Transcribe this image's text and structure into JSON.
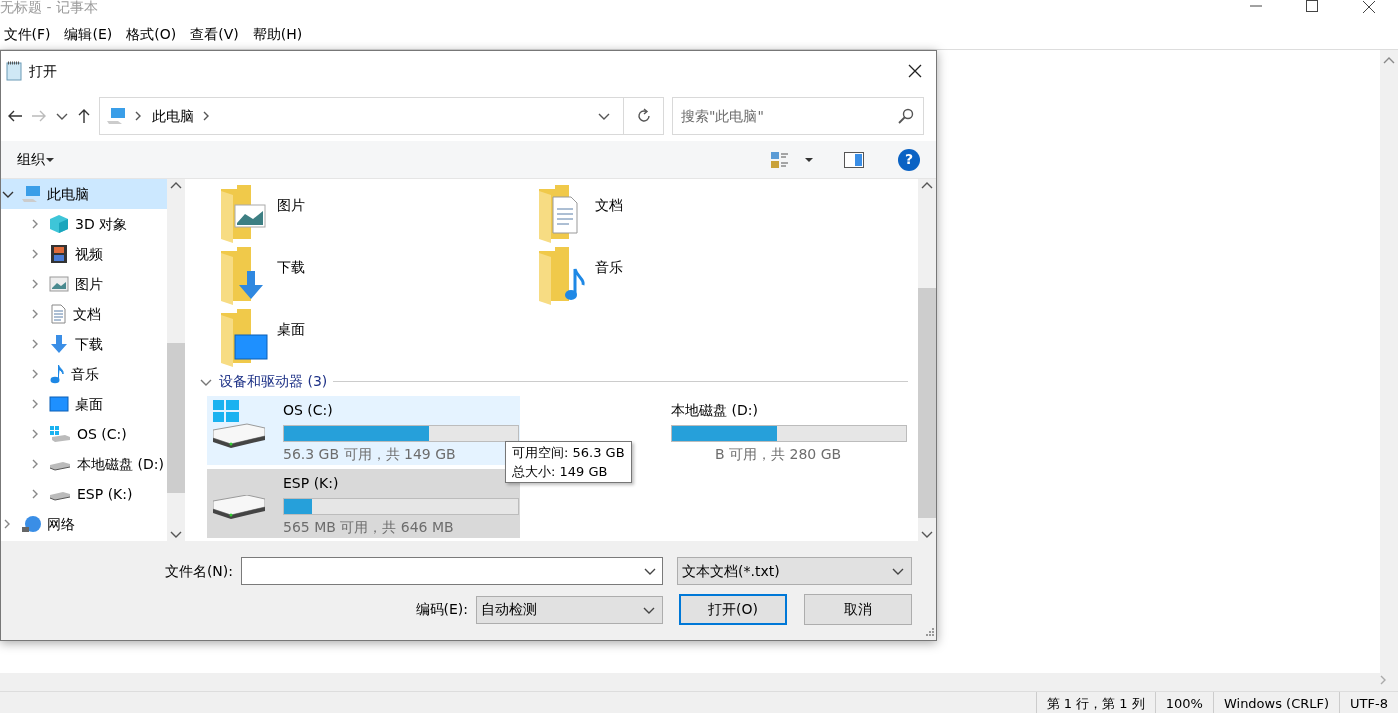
{
  "notepad": {
    "title": "无标题 - 记事本",
    "menu": [
      "文件(F)",
      "编辑(E)",
      "格式(O)",
      "查看(V)",
      "帮助(H)"
    ],
    "status_bar": [
      "第 1 行，第 1 列",
      "100%",
      "Windows (CRLF)",
      "UTF-8"
    ]
  },
  "dialog": {
    "title": "打开",
    "address": {
      "path": [
        "此电脑"
      ]
    },
    "search": {
      "placeholder": "搜索\"此电脑\""
    },
    "toolbar": {
      "organize": "组织",
      "help": "?"
    },
    "sidebar": [
      {
        "label": "此电脑",
        "kind": "pc",
        "expanded": true,
        "selected": true,
        "children": [
          {
            "label": "3D 对象",
            "kind": "cube",
            "expanded": false,
            "selected": false
          },
          {
            "label": "视频",
            "kind": "video",
            "expanded": false,
            "selected": false
          },
          {
            "label": "图片",
            "kind": "pictures",
            "expanded": false,
            "selected": false
          },
          {
            "label": "文档",
            "kind": "documents",
            "expanded": false,
            "selected": false
          },
          {
            "label": "下载",
            "kind": "downloads",
            "expanded": false,
            "selected": false
          },
          {
            "label": "音乐",
            "kind": "music",
            "expanded": false,
            "selected": false
          },
          {
            "label": "桌面",
            "kind": "desktop",
            "expanded": false,
            "selected": false
          },
          {
            "label": "OS (C:)",
            "kind": "system-drive",
            "expanded": false,
            "selected": false
          },
          {
            "label": "本地磁盘 (D:)",
            "kind": "drive",
            "expanded": false,
            "selected": false
          },
          {
            "label": "ESP (K:)",
            "kind": "drive",
            "expanded": false,
            "selected": false
          }
        ]
      },
      {
        "label": "网络",
        "kind": "network",
        "expanded": false,
        "selected": false
      }
    ],
    "folders": [
      {
        "label": "图片",
        "kind": "pictures"
      },
      {
        "label": "文档",
        "kind": "documents"
      },
      {
        "label": "下载",
        "kind": "downloads"
      },
      {
        "label": "音乐",
        "kind": "music"
      },
      {
        "label": "桌面",
        "kind": "desktop"
      }
    ],
    "section": {
      "label": "设备和驱动器 (3)",
      "expanded": true
    },
    "drives": [
      {
        "name": "OS (C:)",
        "kind": "system-drive",
        "level": 0.62,
        "free": "56.3 GB 可用，共 149 GB",
        "hovered": true,
        "selected": false,
        "partly_hidden": false
      },
      {
        "name": "本地磁盘 (D:)",
        "level": 0.45,
        "free": "B 可用，共 280 GB",
        "hovered": false,
        "selected": false,
        "partly_hidden": true
      },
      {
        "name": "ESP (K:)",
        "kind": "drive",
        "level": 0.12,
        "free": "565 MB 可用，共 646 MB",
        "hovered": false,
        "selected": true,
        "partly_hidden": false
      }
    ],
    "tooltip": [
      "可用空间: 56.3 GB",
      "总大小: 149 GB"
    ],
    "filename": {
      "label": "文件名(N):"
    },
    "file_type": "文本文档(*.txt)",
    "encoding": {
      "label": "编码(E):",
      "value": "自动检测"
    },
    "buttons": [
      {
        "label": "打开(O)",
        "default": true
      },
      {
        "label": "取消",
        "default": false
      }
    ]
  }
}
